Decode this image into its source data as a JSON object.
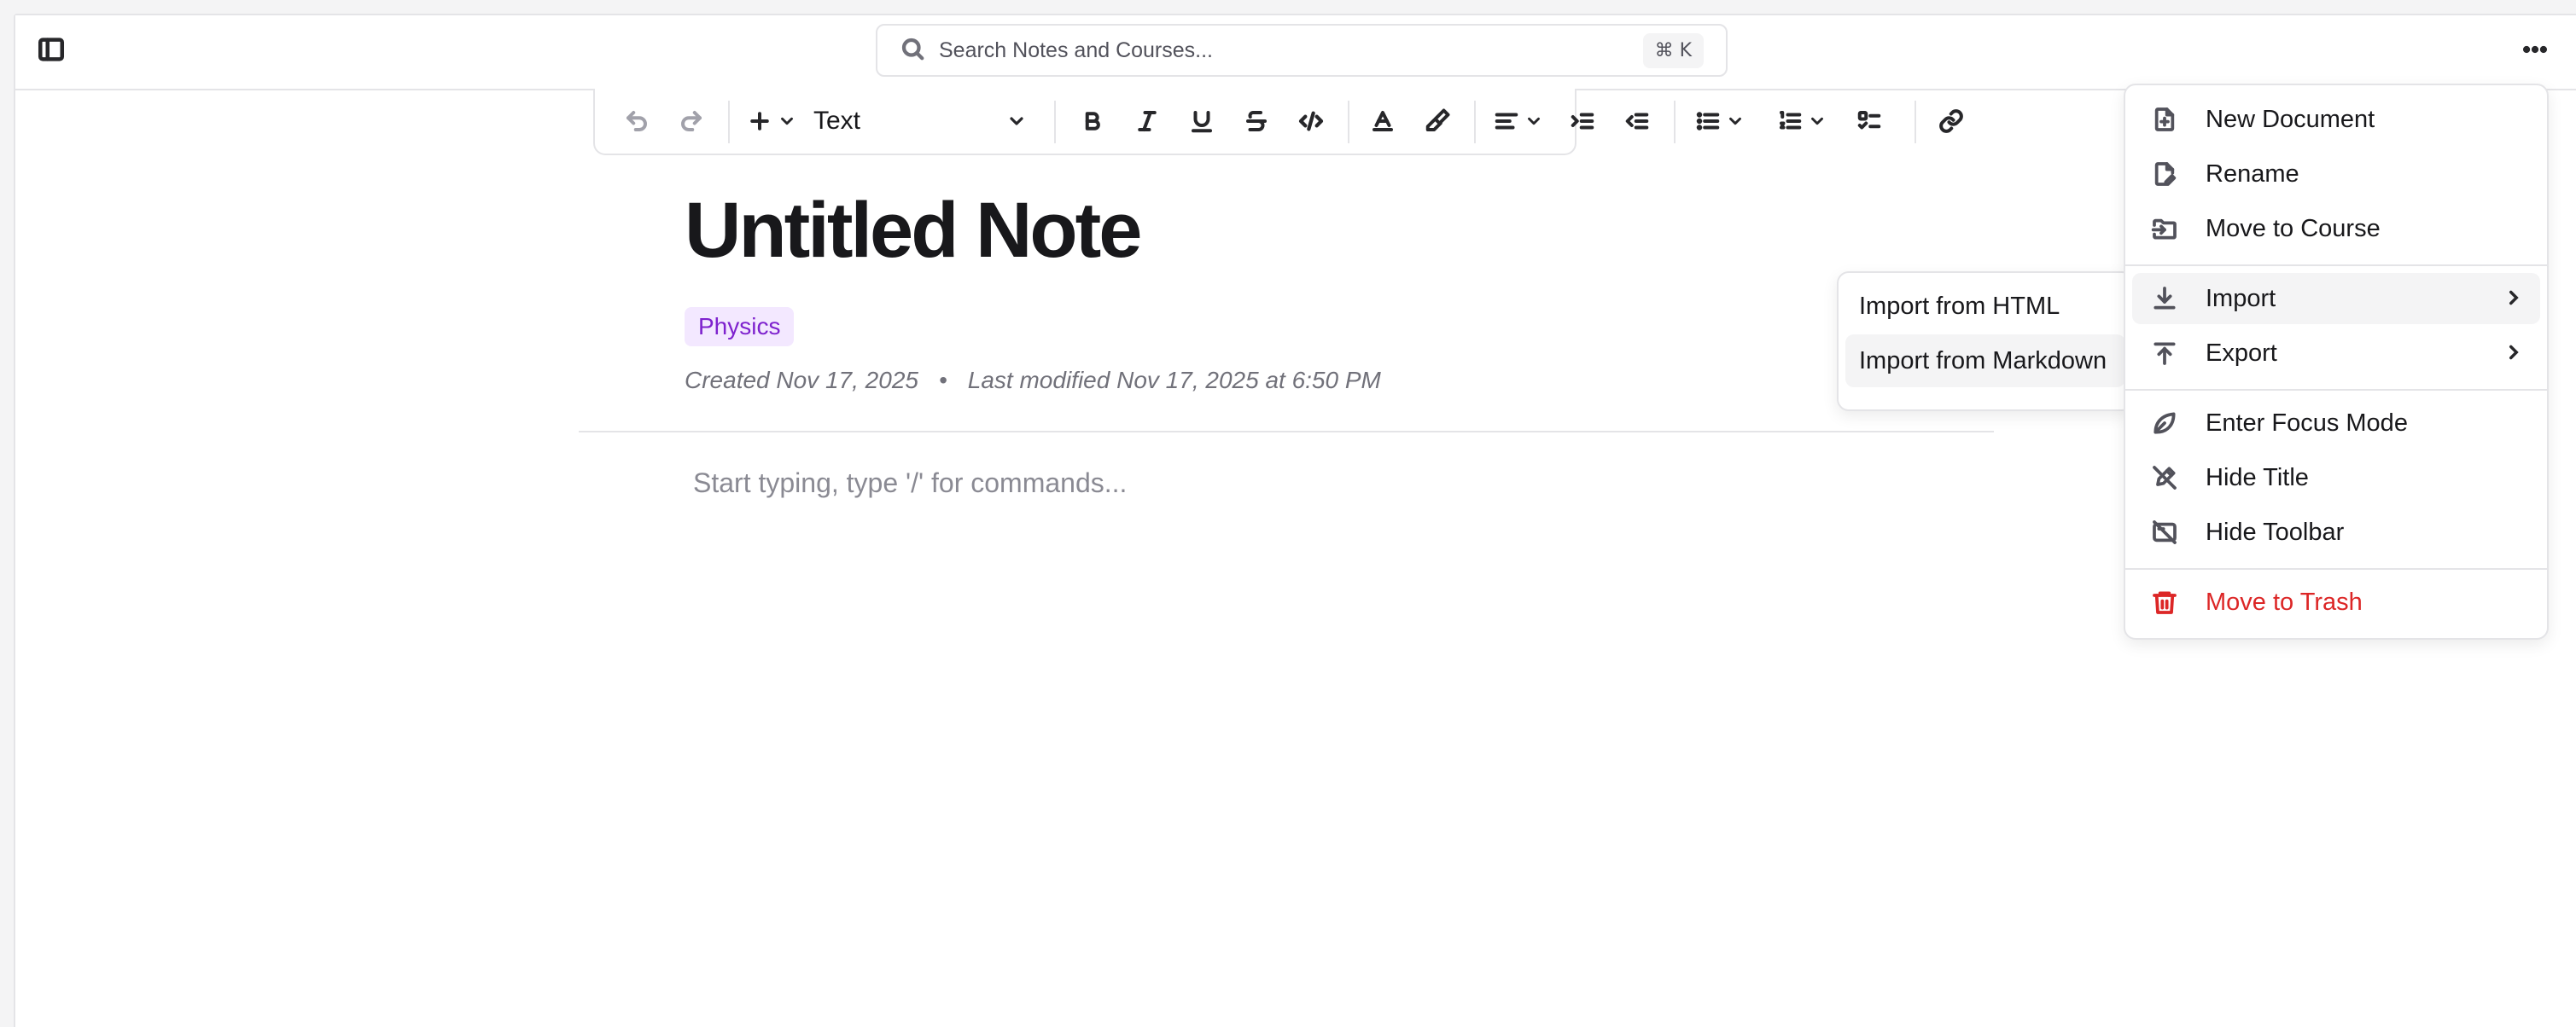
{
  "search": {
    "placeholder": "Search Notes and Courses...",
    "shortcut": "⌘ K"
  },
  "toolbar": {
    "block_type": "Text"
  },
  "note": {
    "title": "Untitled Note",
    "tag": "Physics",
    "tag_color": "#7e22ce",
    "created": "Created Nov 17, 2025",
    "separator": "•",
    "modified": "Last modified Nov 17, 2025 at 6:50 PM",
    "body_placeholder": "Start typing, type '/' for commands..."
  },
  "menu": {
    "items": [
      {
        "label": "New Document",
        "icon": "file-plus-icon"
      },
      {
        "label": "Rename",
        "icon": "file-pen-icon"
      },
      {
        "label": "Move to Course",
        "icon": "folder-input-icon"
      },
      {
        "label": "Import",
        "icon": "download-icon"
      },
      {
        "label": "Export",
        "icon": "upload-icon"
      },
      {
        "label": "Enter Focus Mode",
        "icon": "leaf-icon"
      },
      {
        "label": "Hide Title",
        "icon": "pen-off-icon"
      },
      {
        "label": "Hide Toolbar",
        "icon": "toolbar-off-icon"
      },
      {
        "label": "Move to Trash",
        "icon": "trash-icon",
        "color": "#dc2626"
      }
    ]
  },
  "submenu": {
    "items": [
      {
        "label": "Import from HTML"
      },
      {
        "label": "Import from Markdown"
      }
    ]
  }
}
